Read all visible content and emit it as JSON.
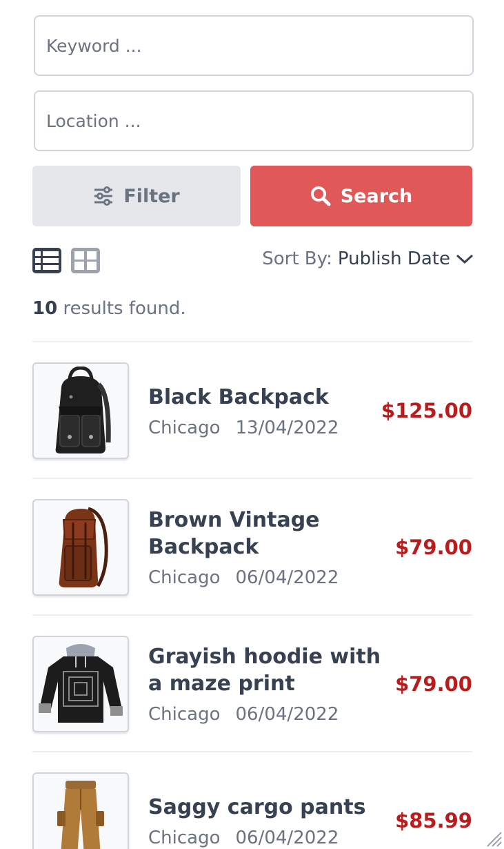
{
  "search": {
    "keyword_placeholder": "Keyword ...",
    "location_placeholder": "Location ...",
    "filter_label": "Filter",
    "search_label": "Search",
    "accent_color": "#e05858"
  },
  "toolbar": {
    "sort_label": "Sort By:",
    "sort_value": "Publish Date"
  },
  "results": {
    "count": "10",
    "suffix": "results found."
  },
  "items": [
    {
      "title": "Black Backpack",
      "location": "Chicago",
      "date": "13/04/2022",
      "price": "$125.00",
      "icon": "black-backpack"
    },
    {
      "title": "Brown Vintage Backpack",
      "location": "Chicago",
      "date": "06/04/2022",
      "price": "$79.00",
      "icon": "brown-backpack"
    },
    {
      "title": "Grayish hoodie with a maze print",
      "location": "Chicago",
      "date": "06/04/2022",
      "price": "$79.00",
      "icon": "hoodie"
    },
    {
      "title": "Saggy cargo pants",
      "location": "Chicago",
      "date": "06/04/2022",
      "price": "$85.99",
      "icon": "cargo-pants"
    }
  ]
}
